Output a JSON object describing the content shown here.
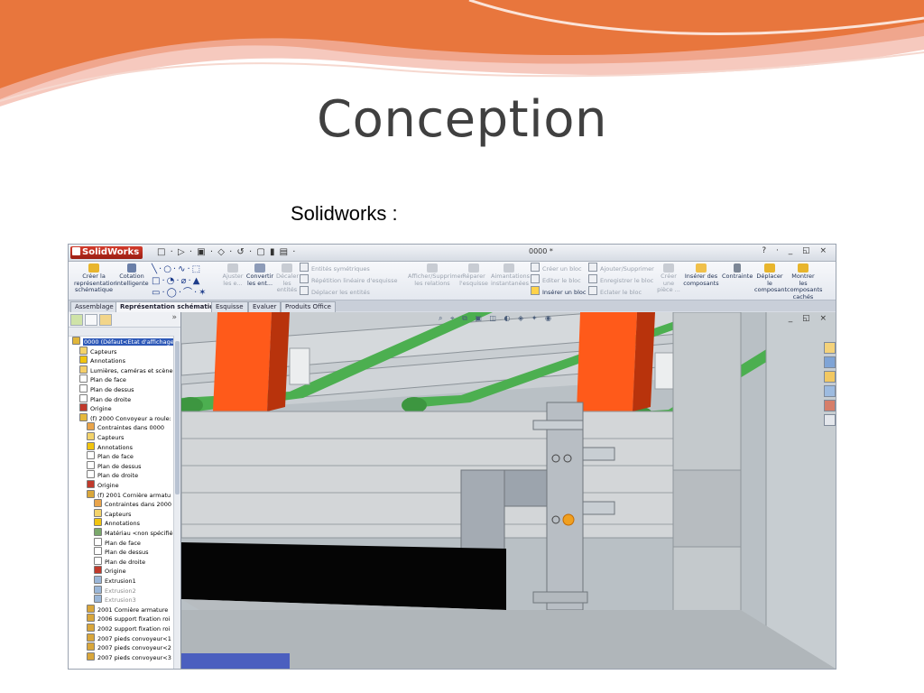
{
  "slide": {
    "title": "Conception",
    "subtitle": "Solidworks :"
  },
  "colors": {
    "title_text": "#404040",
    "wave_orange": "#e8763d",
    "wave_pink": "#f3b7a8",
    "selection_blue": "#2d58b7",
    "conveyor_orange": "#ff5a1a",
    "conveyor_green": "#4caf50"
  },
  "app": {
    "name": "SolidWorks",
    "document_title": "0000 *",
    "window_controls": "? · _ ◱ ×",
    "quick_access": "□ · ▷ · ▣ · ◇ · ↺ · ▢ ▮ ▤ ·"
  },
  "ribbon": {
    "creer_representation": "Créer la représentation schématique",
    "cotation": "Cotation intelligente",
    "ajuster": "Ajuster les e...",
    "convertir": "Convertir les ent...",
    "decaler": "Décaler les entités",
    "entites_symetriques": "Entités symétriques",
    "repetition": "Répétition linéaire d'esquisse",
    "deplacer_entites": "Déplacer les entités",
    "afficher_relations": "Afficher/Supprimer les relations",
    "reparer": "Réparer l'esquisse",
    "aimantations": "Aimantations instantanées",
    "creer_bloc": "Créer un bloc",
    "editer_bloc": "Editer le bloc",
    "inserer_bloc": "Insérer un bloc",
    "ajouter_supprimer": "Ajouter/Supprimer",
    "enregistrer_bloc": "Enregistrer le bloc",
    "eclater_bloc": "Eclater le bloc",
    "creer_piece": "Créer une pièce ...",
    "inserer_composants": "Insérer des composants",
    "contrainte": "Contrainte",
    "deplacer_composant": "Déplacer le composant",
    "montrer_composants": "Montrer les composants cachés"
  },
  "tabs": [
    "Assemblage",
    "Représentation schématique",
    "Esquisse",
    "Evaluer",
    "Produits Office"
  ],
  "tree": [
    {
      "label": "0000  (Défaut<Etat d'affichage-",
      "icon": "assembly-icon",
      "selected": true
    },
    {
      "label": "Capteurs",
      "icon": "sensor-icon"
    },
    {
      "label": "Annotations",
      "icon": "annotation-icon"
    },
    {
      "label": "Lumières, caméras et scène",
      "icon": "lights-icon"
    },
    {
      "label": "Plan de face",
      "icon": "plane-icon"
    },
    {
      "label": "Plan de dessus",
      "icon": "plane-icon"
    },
    {
      "label": "Plan de droite",
      "icon": "plane-icon"
    },
    {
      "label": "Origine",
      "icon": "origin-icon"
    },
    {
      "label": "(f) 2000  Convoyeur a roule:",
      "icon": "subassembly-icon"
    },
    {
      "label": "Contraintes dans 0000",
      "icon": "mates-icon"
    },
    {
      "label": "Capteurs",
      "icon": "sensor-icon"
    },
    {
      "label": "Annotations",
      "icon": "annotation-icon"
    },
    {
      "label": "Plan de face",
      "icon": "plane-icon"
    },
    {
      "label": "Plan de dessus",
      "icon": "plane-icon"
    },
    {
      "label": "Plan de droite",
      "icon": "plane-icon"
    },
    {
      "label": "Origine",
      "icon": "origin-icon"
    },
    {
      "label": "(f) 2001 Cornière armatu",
      "icon": "part-icon"
    },
    {
      "label": "Contraintes dans 2000",
      "icon": "mates-icon"
    },
    {
      "label": "Capteurs",
      "icon": "sensor-icon"
    },
    {
      "label": "Annotations",
      "icon": "annotation-icon"
    },
    {
      "label": "Matériau <non spécifié>",
      "icon": "material-icon"
    },
    {
      "label": "Plan de face",
      "icon": "plane-icon"
    },
    {
      "label": "Plan de dessus",
      "icon": "plane-icon"
    },
    {
      "label": "Plan de droite",
      "icon": "plane-icon"
    },
    {
      "label": "Origine",
      "icon": "origin-icon"
    },
    {
      "label": "Extrusion1",
      "icon": "extrude-icon"
    },
    {
      "label": "Extrusion2",
      "icon": "extrude-icon",
      "gray": true
    },
    {
      "label": "Extrusion3",
      "icon": "extrude-icon",
      "gray": true
    },
    {
      "label": "2001 Cornière armature",
      "icon": "part-icon"
    },
    {
      "label": "2006 support fixation roi",
      "icon": "part-icon"
    },
    {
      "label": "2002 support fixation roi",
      "icon": "part-icon"
    },
    {
      "label": "2007 pieds convoyeur<1",
      "icon": "part-icon"
    },
    {
      "label": "2007 pieds convoyeur<2",
      "icon": "part-icon"
    },
    {
      "label": "2007 pieds convoyeur<3",
      "icon": "part-icon"
    }
  ],
  "viewport": {
    "heads_up_toolbar": "⌕ ⌖ ⧉ ▣ ◫ ◐ ◈ ✦ ◉",
    "controls": "_ ◱ ×"
  }
}
